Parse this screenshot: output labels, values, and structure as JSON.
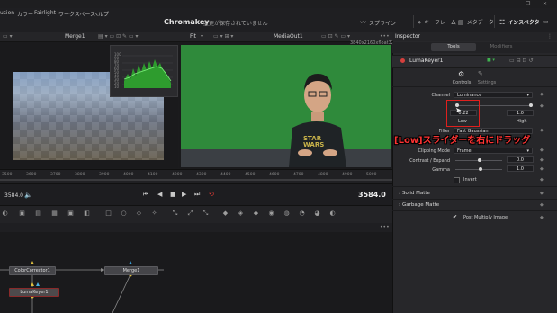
{
  "menu": {
    "items": [
      "usion",
      "カラー",
      "Fairlight",
      "ワークスペース",
      "ヘルプ"
    ]
  },
  "window": {
    "minimize": "—",
    "maximize": "❐",
    "close": "✕"
  },
  "app": {
    "title": "Chromakey",
    "status": "変更が保存されていません"
  },
  "top_tabs": [
    {
      "icon": "spline-icon",
      "label": "スプライン"
    },
    {
      "icon": "keyframe-icon",
      "label": "キーフレーム"
    },
    {
      "icon": "metadata-icon",
      "label": "メタデータ"
    },
    {
      "icon": "inspector-icon",
      "label": "インスペクタ"
    }
  ],
  "viewer": {
    "left_node": "Merge1",
    "fit": "Fit",
    "right_node": "MediaOut1",
    "resolution": "3840x2160xfloat32",
    "menu": "•••"
  },
  "histogram": {
    "labels": [
      "100",
      "90",
      "80",
      "70",
      "60",
      "50",
      "40",
      "30",
      "20",
      "10"
    ]
  },
  "ruler": {
    "ticks": [
      "3500",
      "3600",
      "3700",
      "3800",
      "3900",
      "4000",
      "4100",
      "4200",
      "4300",
      "4400",
      "4500",
      "4600",
      "4700",
      "4800",
      "4900",
      "5000"
    ]
  },
  "transport": {
    "timecode_left": "3584.0",
    "timecode_right": "3584.0"
  },
  "nodes": {
    "color_corrector": "ColorCorrector1",
    "merge": "Merge1",
    "luma_keyer": "LumaKeyer1"
  },
  "inspector": {
    "title": "Inspector",
    "tabs": {
      "tools": "Tools",
      "modifiers": "Modifiers"
    },
    "node_name": "LumaKeyer1",
    "sub_tabs": {
      "controls": "Controls",
      "settings": "Settings"
    },
    "channel": {
      "label": "Channel",
      "value": "Luminance"
    },
    "low_high": {
      "low_value": "0.22",
      "high_value": "1.0",
      "low_label": "Low",
      "high_label": "High"
    },
    "filter": {
      "label": "Filter",
      "value": "Fast Gaussian"
    },
    "clipping": {
      "label": "Clipping Mode",
      "value": "Frame"
    },
    "contrast": {
      "label": "Contrast / Expand",
      "value": "0.0"
    },
    "gamma": {
      "label": "Gamma",
      "value": "1.0"
    },
    "invert": {
      "label": "Invert"
    },
    "solid_matte": "Solid Matte",
    "garbage_matte": "Garbage Matte",
    "post_multiply": "Post Multiply Image"
  },
  "annotation": {
    "text": "[Low]スライダーを右にドラッグ"
  },
  "colors": {
    "accent_red": "#e0201e",
    "green_screen": "#2f8a3b",
    "histogram_green": "#3ccf3c"
  }
}
